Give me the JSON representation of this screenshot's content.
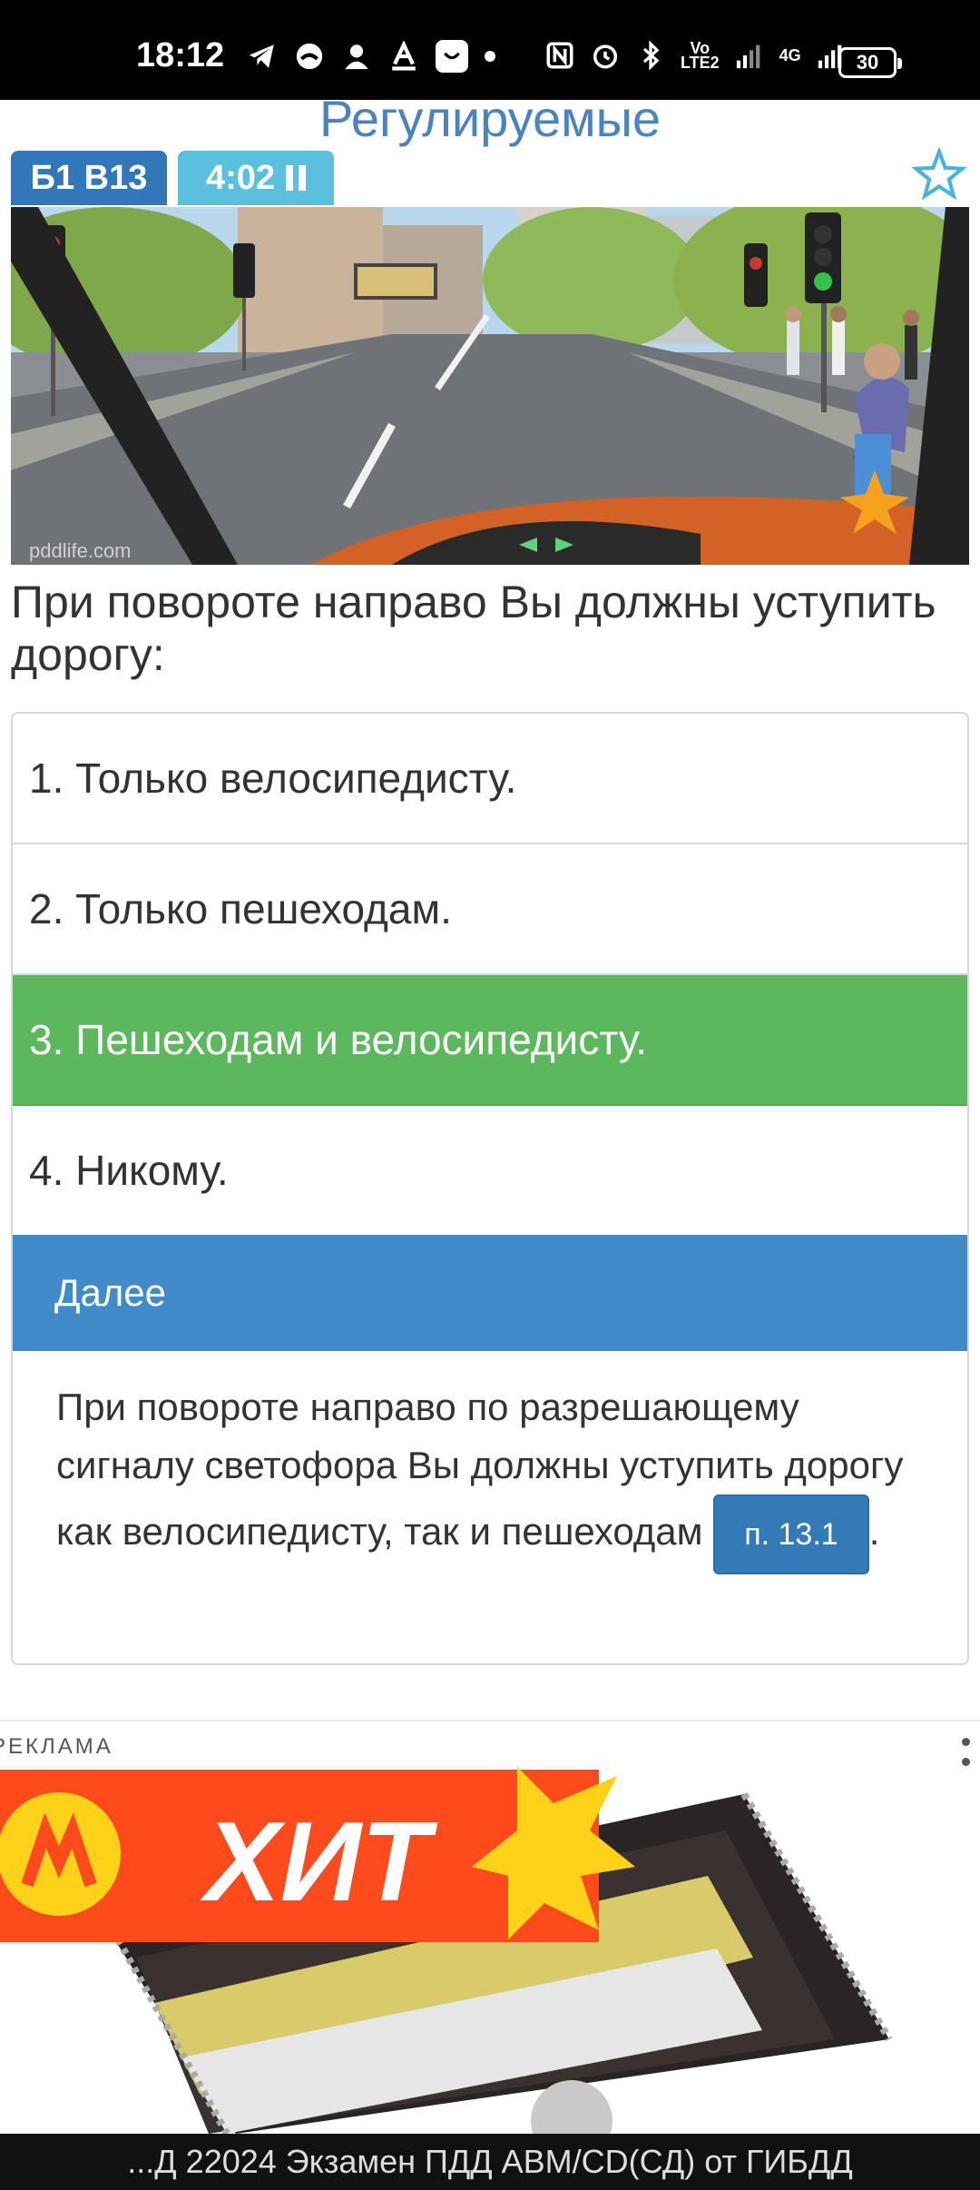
{
  "status_bar": {
    "time": "18:12",
    "network_label_top": "Vo",
    "network_label_bottom": "LTE2",
    "network_type": "4G",
    "battery": "30",
    "icons": [
      "telegram-icon",
      "message-icon",
      "person-icon",
      "text-a-icon",
      "app-icon",
      "nfc-icon",
      "alarm-icon",
      "bluetooth-icon",
      "signal-icon",
      "signal-icon-2"
    ]
  },
  "header": {
    "topic": "Регулируемые",
    "ticket": "Б1 В13",
    "timer": "4:02"
  },
  "question": {
    "text": "При повороте направо Вы должны уступить дорогу:",
    "watermark": "pddlife.com"
  },
  "answers": [
    {
      "label": "1. Только велосипедисту.",
      "correct": false
    },
    {
      "label": "2. Только пешеходам.",
      "correct": false
    },
    {
      "label": "3. Пешеходам и велосипедисту.",
      "correct": true
    },
    {
      "label": "4. Никому.",
      "correct": false
    }
  ],
  "next_label": "Далее",
  "explanation": {
    "text": "При повороте направо по разрешающему сигналу светофора Вы должны уступить дорогу как велосипедисту, так и пешеходам",
    "rule_ref": "п. 13.1",
    "suffix": "."
  },
  "ad": {
    "label": "РЕКЛАМА",
    "hit": "ХИТ",
    "caption": "...Д 22024 Экзамен ПДД ABM/CD(СД) от ГИБДД"
  },
  "colors": {
    "header_blue": "#4a83c0",
    "ticket_badge": "#3177b9",
    "timer_badge": "#5bc0de",
    "correct_green": "#5cb85c",
    "next_blue": "#428bca",
    "ad_orange": "#ff4a1c"
  }
}
